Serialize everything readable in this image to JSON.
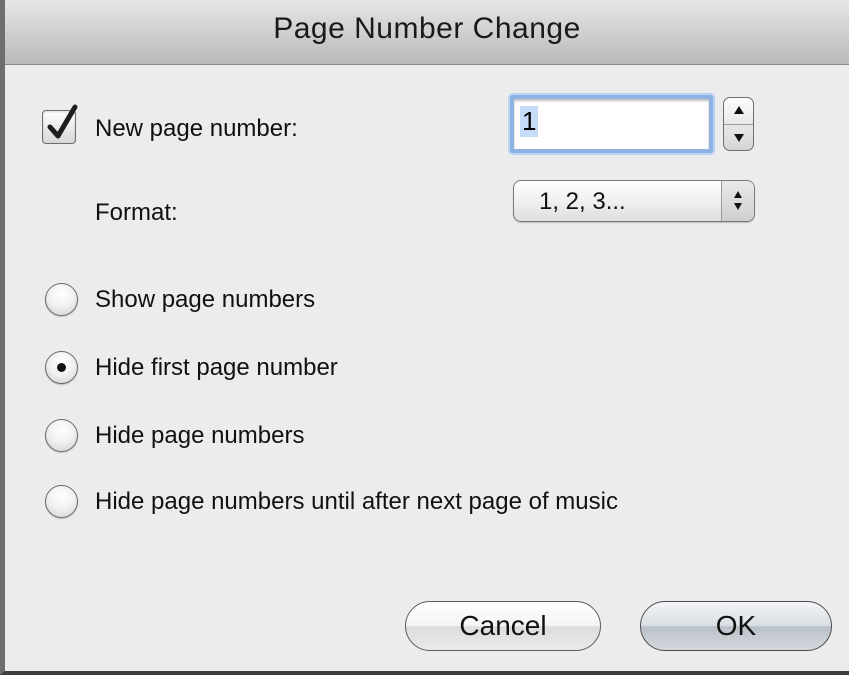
{
  "dialog": {
    "title": "Page Number Change"
  },
  "new_page_number": {
    "checkbox_checked": true,
    "label": "New page number:",
    "value": "1"
  },
  "format": {
    "label": "Format:",
    "selected": "1, 2, 3..."
  },
  "radios": [
    {
      "label": "Show page numbers",
      "selected": false
    },
    {
      "label": "Hide first page number",
      "selected": true
    },
    {
      "label": "Hide page numbers",
      "selected": false
    },
    {
      "label": "Hide page numbers until after next page of music",
      "selected": false
    }
  ],
  "buttons": {
    "cancel": "Cancel",
    "ok": "OK"
  }
}
